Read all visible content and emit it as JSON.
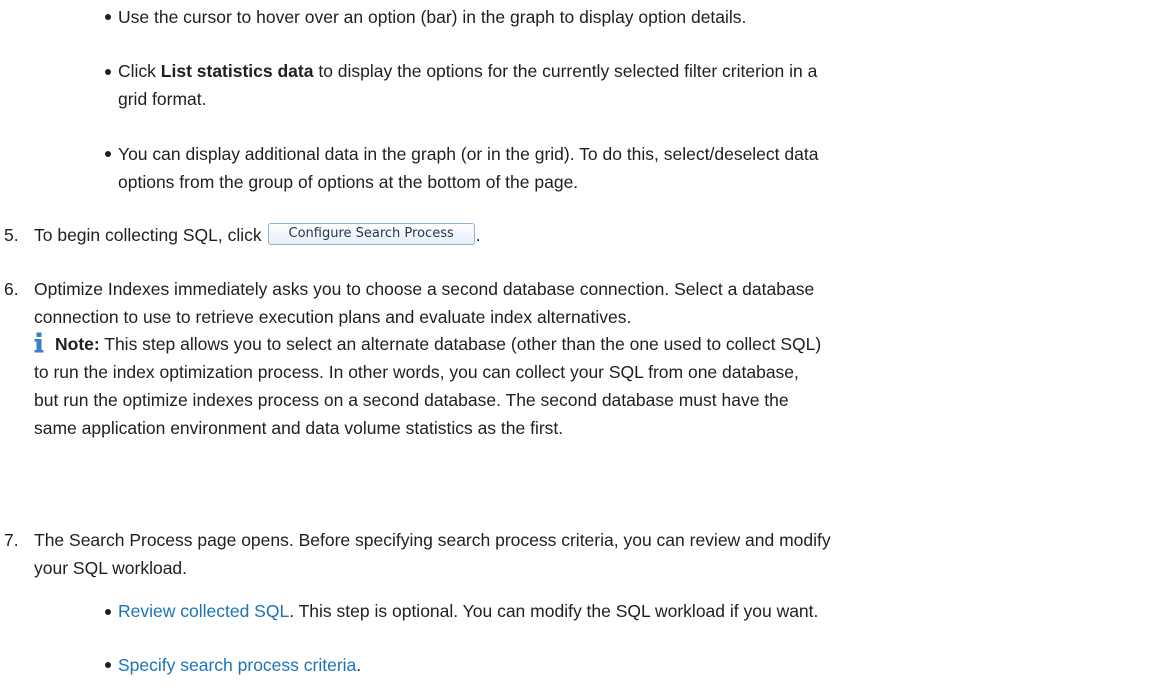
{
  "bullets_top": [
    {
      "text": "Use the cursor to hover over an option (bar) in the graph to display option details."
    },
    {
      "prefix": "Click ",
      "bold": "List statistics data",
      "line1_rest": " to display the options for the currently selected filter criterion in a",
      "line2": "grid format."
    },
    {
      "line1": "You can display additional data in the graph (or in the grid). To do this, select/deselect data",
      "line2": "options from the group of options at the bottom of the page."
    }
  ],
  "step5": {
    "number": "5.",
    "text_before": "To begin collecting SQL, click",
    "button_label": "Configure Search Process",
    "text_after": "."
  },
  "step6": {
    "number": "6.",
    "line1": "Optimize Indexes immediately asks you to choose a second database connection. Select a database",
    "line2": "connection to use to retrieve execution plans and evaluate index alternatives.",
    "note": {
      "icon": "info-icon",
      "label": "Note:",
      "line1": " This step allows you to select an alternate database (other than the one used to collect SQL)",
      "line2": "to run the index optimization process. In other words, you can collect your SQL from one database,",
      "line3": "but run the optimize indexes process on a second database. The second database must have the",
      "line4": "same application environment and data volume statistics as the first."
    }
  },
  "step7": {
    "number": "7.",
    "line1": "The Search Process page opens. Before specifying search process criteria, you can review and modify",
    "line2": "your SQL workload.",
    "bullets": [
      {
        "link": "Review collected SQL",
        "rest": ". This step is optional. You can modify the SQL workload if you want."
      },
      {
        "link": "Specify search process criteria",
        "rest": "."
      }
    ]
  },
  "colors": {
    "text": "#1f1f1f",
    "link": "#1a73b8",
    "info_icon": "#3a7fc8"
  }
}
